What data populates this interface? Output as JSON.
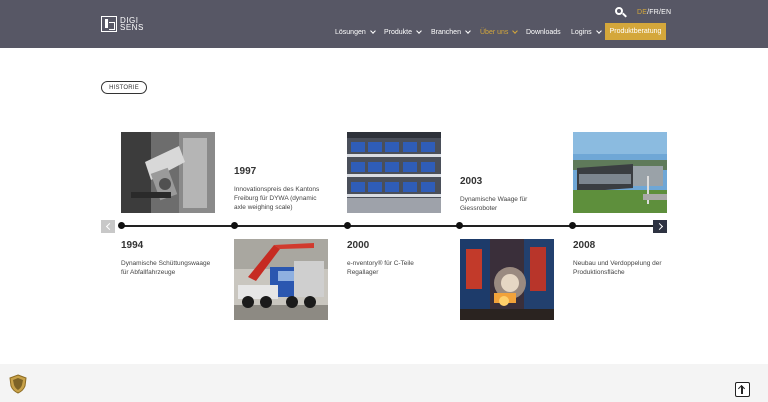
{
  "header": {
    "logo": {
      "line1": "DIGI",
      "line2": "SENS"
    },
    "lang": {
      "active": "DE",
      "rest": "/FR/EN"
    },
    "nav": [
      {
        "label": "Lösungen",
        "chevron": true
      },
      {
        "label": "Produkte",
        "chevron": true
      },
      {
        "label": "Branchen",
        "chevron": true
      },
      {
        "label": "Über uns",
        "chevron": true,
        "active": true
      },
      {
        "label": "Downloads",
        "chevron": false
      },
      {
        "label": "Logins",
        "chevron": true
      }
    ],
    "cta": "Produktberatung"
  },
  "section_badge": "HISTORIE",
  "timeline": [
    {
      "year": "1994",
      "text": "Dynamische Schüttungswaage für Abfallfahrzeuge",
      "photo": "loader-mechanism"
    },
    {
      "year": "1997",
      "text": "Innovationspreis des Kantons Freiburg für DYWA (dynamic axle weighing scale)",
      "photo": "truck-crane"
    },
    {
      "year": "2000",
      "text": "e-nventory® für C-Teile Regallager",
      "photo": "shelving-bins"
    },
    {
      "year": "2003",
      "text": "Dynamische Waage für Giessroboter",
      "photo": "casting-robot"
    },
    {
      "year": "2008",
      "text": "Neubau und Verdoppelung der Produktionsfläche",
      "photo": "building"
    }
  ],
  "colors": {
    "header_bg": "#575765",
    "accent": "#d4a73b",
    "footer_bg": "#f4f4f4"
  }
}
